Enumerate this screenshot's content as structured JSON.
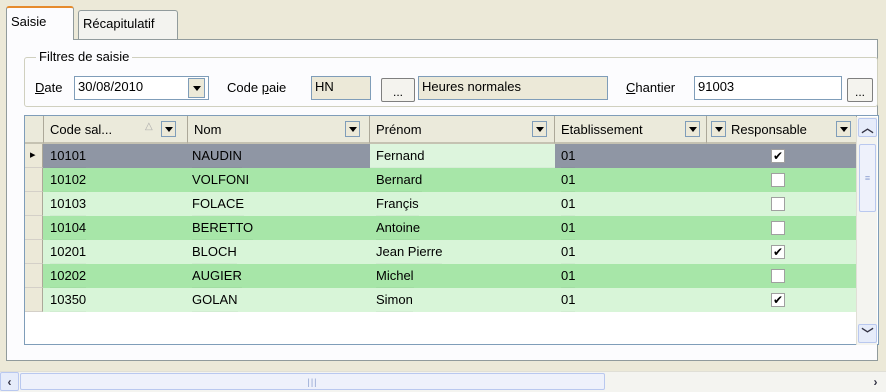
{
  "tabs": [
    "Saisie",
    "Récapitulatif"
  ],
  "group_title": "Filtres de saisie",
  "filters": {
    "date_label_u": "D",
    "date_label_rest": "ate",
    "date_value": "30/08/2010",
    "code_paie_label_a": "Code ",
    "code_paie_label_u": "p",
    "code_paie_label_b": "aie",
    "code_paie_value": "HN",
    "ellipsis": "...",
    "code_paie_desc": "Heures normales",
    "chantier_label_u": "C",
    "chantier_label_rest": "hantier",
    "chantier_value": "91003"
  },
  "grid": {
    "columns": [
      "Code sal...",
      "Nom",
      "Prénom",
      "Etablissement",
      "Responsable"
    ],
    "current_row_marker": "▸",
    "rows": [
      {
        "code": "10101",
        "nom": "NAUDIN",
        "prenom": "Fernand",
        "etab": "01",
        "resp": true
      },
      {
        "code": "10102",
        "nom": "VOLFONI",
        "prenom": "Bernard",
        "etab": "01",
        "resp": false
      },
      {
        "code": "10103",
        "nom": "FOLACE",
        "prenom": "Françis",
        "etab": "01",
        "resp": false
      },
      {
        "code": "10104",
        "nom": "BERETTO",
        "prenom": "Antoine",
        "etab": "01",
        "resp": false
      },
      {
        "code": "10201",
        "nom": "BLOCH",
        "prenom": "Jean Pierre",
        "etab": "01",
        "resp": true
      },
      {
        "code": "10202",
        "nom": "AUGIER",
        "prenom": "Michel",
        "etab": "01",
        "resp": false
      },
      {
        "code": "10350",
        "nom": "GOLAN",
        "prenom": "Simon",
        "etab": "01",
        "resp": true
      }
    ]
  },
  "colors": {
    "row_selected": "#8f96a4",
    "row_green": "#a7e6a8",
    "row_light": "#d8f5d8",
    "prenom_selected": "#ddf5dd"
  }
}
